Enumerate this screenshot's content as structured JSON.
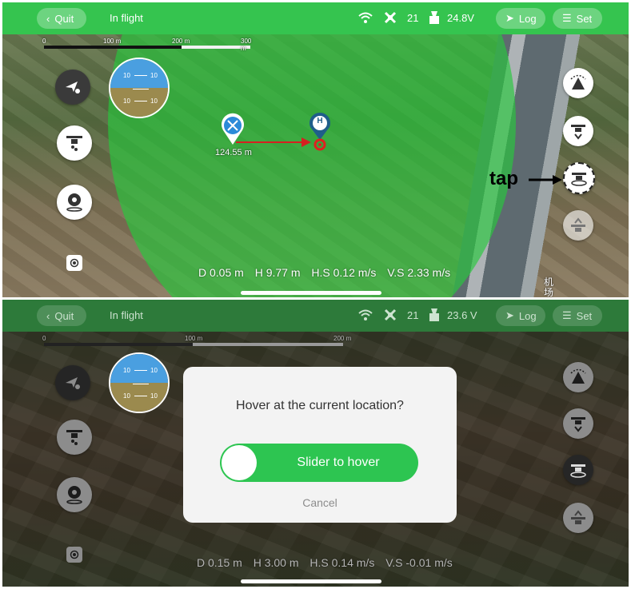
{
  "top": {
    "quit": "Quit",
    "status": "In flight",
    "satellites": "21",
    "voltage": "24.8V",
    "log": "Log",
    "set": "Set",
    "scale": [
      "0",
      "100 m",
      "200 m",
      "300 m"
    ]
  },
  "map": {
    "distance_label": "124.55 m",
    "home_letter": "H",
    "road_label_1": "机",
    "road_label_2": "场"
  },
  "horizon": {
    "ticks": [
      "10",
      "10",
      "10",
      "10"
    ]
  },
  "telemetry": {
    "d": "D 0.05 m",
    "h": "H 9.77 m",
    "hs": "H.S 0.12 m/s",
    "vs": "V.S 2.33 m/s"
  },
  "annotation": {
    "tap": "tap"
  },
  "bottom": {
    "quit": "Quit",
    "status": "In flight",
    "satellites": "21",
    "voltage": "23.6 V",
    "log": "Log",
    "set": "Set",
    "scale": [
      "0",
      "100 m",
      "200 m"
    ],
    "telemetry": {
      "d": "D 0.15 m",
      "h": "H 3.00 m",
      "hs": "H.S 0.14 m/s",
      "vs": "V.S -0.01 m/s"
    }
  },
  "dialog": {
    "question": "Hover at the current location?",
    "slider": "Slider to hover",
    "cancel": "Cancel"
  },
  "colors": {
    "topbar": "#35c44f",
    "accent": "#2dc551",
    "home_pin": "#1f5e8a",
    "drone_pin": "#ffffff",
    "arrow": "#d62020"
  }
}
